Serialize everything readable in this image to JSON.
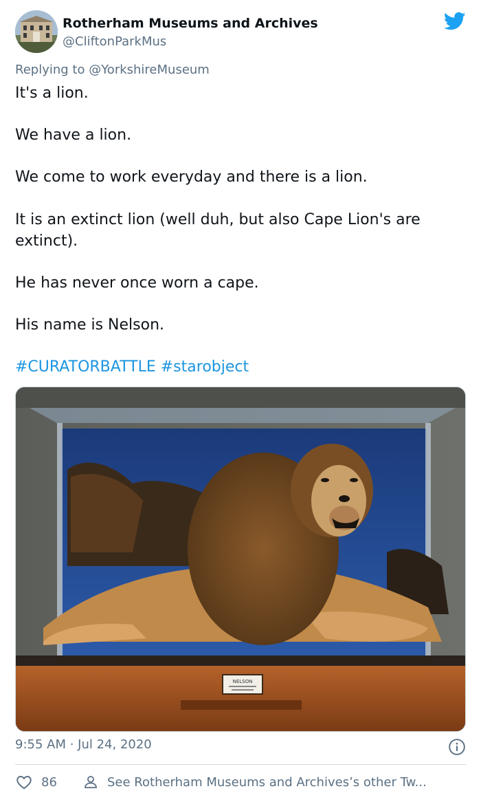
{
  "author": {
    "name": "Rotherham Museums and Archives",
    "handle": "@CliftonParkMus"
  },
  "reply": {
    "prefix": "Replying to ",
    "mention": "@YorkshireMuseum"
  },
  "tweet": {
    "lines": [
      "It's a lion.",
      "We have a lion.",
      "We come to work everyday and there is a lion.",
      "It is an extinct lion (well duh, but also Cape Lion's are",
      "extinct).",
      "He has never once worn a cape.",
      "His name is Nelson."
    ],
    "hashtags": "#CURATORBATTLE #starobject"
  },
  "photo": {
    "plaque_text": "NELSON"
  },
  "meta": {
    "timestamp": "9:55 AM · Jul 24, 2020"
  },
  "actions": {
    "like_count": "86",
    "other_tweets_label": "See Rotherham Museums and Archives’s other Tw..."
  },
  "colors": {
    "twitter_blue": "#1da1f2",
    "link_blue": "#1b95e0",
    "secondary_text": "#5b7083"
  },
  "icons": [
    "twitter-bird-icon",
    "info-icon",
    "heart-icon",
    "person-icon"
  ]
}
